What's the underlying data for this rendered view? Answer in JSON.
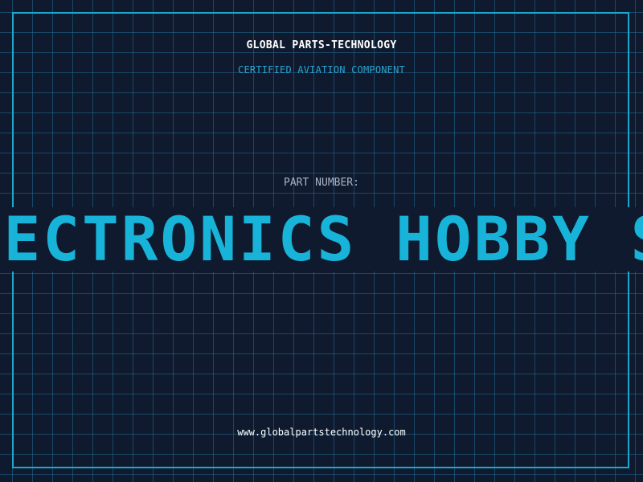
{
  "label": {
    "company": "GLOBAL PARTS-TECHNOLOGY",
    "subtitle": "CERTIFIED AVIATION COMPONENT",
    "part_number_label": "PART NUMBER:",
    "part_number_value": "ELECTRONICS HOBBY STORE",
    "website": "www.globalpartstechnology.com"
  },
  "colors": {
    "background": "#101a2e",
    "grid": "#1e6e96",
    "frame": "#1ba7d0",
    "accent": "#17b3d8",
    "subtitle": "#2aa3d0",
    "text": "#ffffff",
    "muted": "#a9b4c4"
  }
}
